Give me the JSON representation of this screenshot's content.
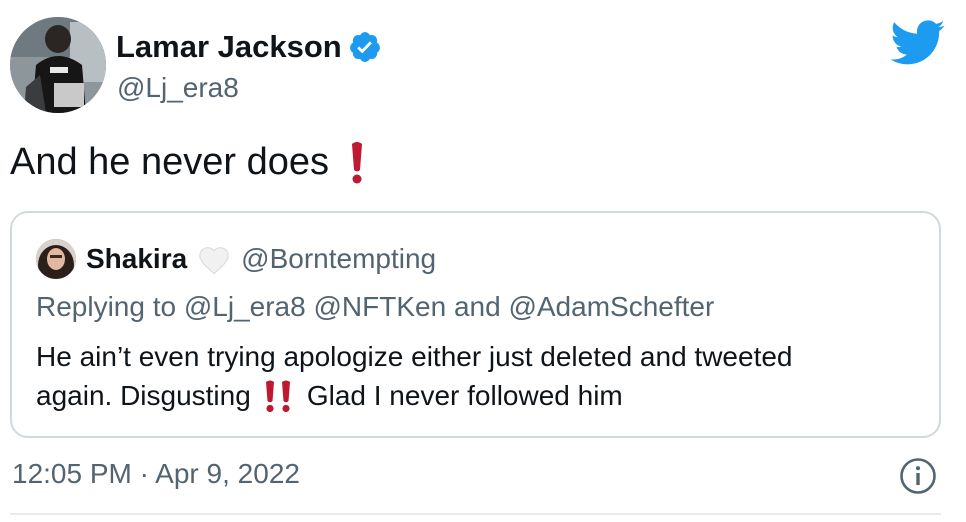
{
  "author": {
    "name": "Lamar Jackson",
    "handle": "@Lj_era8",
    "avatar_icon": "avatar-photo",
    "verified_icon": "verified-badge-icon",
    "verified_color": "#1d9bf0"
  },
  "brand": {
    "logo_icon": "twitter-bird-icon",
    "color": "#1d9bf0"
  },
  "tweet": {
    "text": "And he never does",
    "emoji": "❗"
  },
  "quote": {
    "name": "Shakira",
    "heart_icon": "white-heart-icon",
    "handle": "@Borntempting",
    "replying_prefix": "Replying to",
    "replying_mention_1": "@Lj_era8",
    "replying_mention_2": "@NFTKen",
    "replying_and": "and",
    "replying_mention_3": "@AdamSchefter",
    "body_line_1": "He ain’t even trying apologize either just deleted and tweeted",
    "body_line_2_start": "again. Disgusting",
    "body_emoji": "‼️",
    "body_line_2_end": "Glad I never followed him"
  },
  "footer": {
    "timestamp": "12:05 PM · Apr 9, 2022",
    "info_icon": "info-icon"
  },
  "colors": {
    "text": "#0f1419",
    "secondary": "#536471",
    "border": "#cfd9de",
    "emoji_red": "#be1931"
  }
}
